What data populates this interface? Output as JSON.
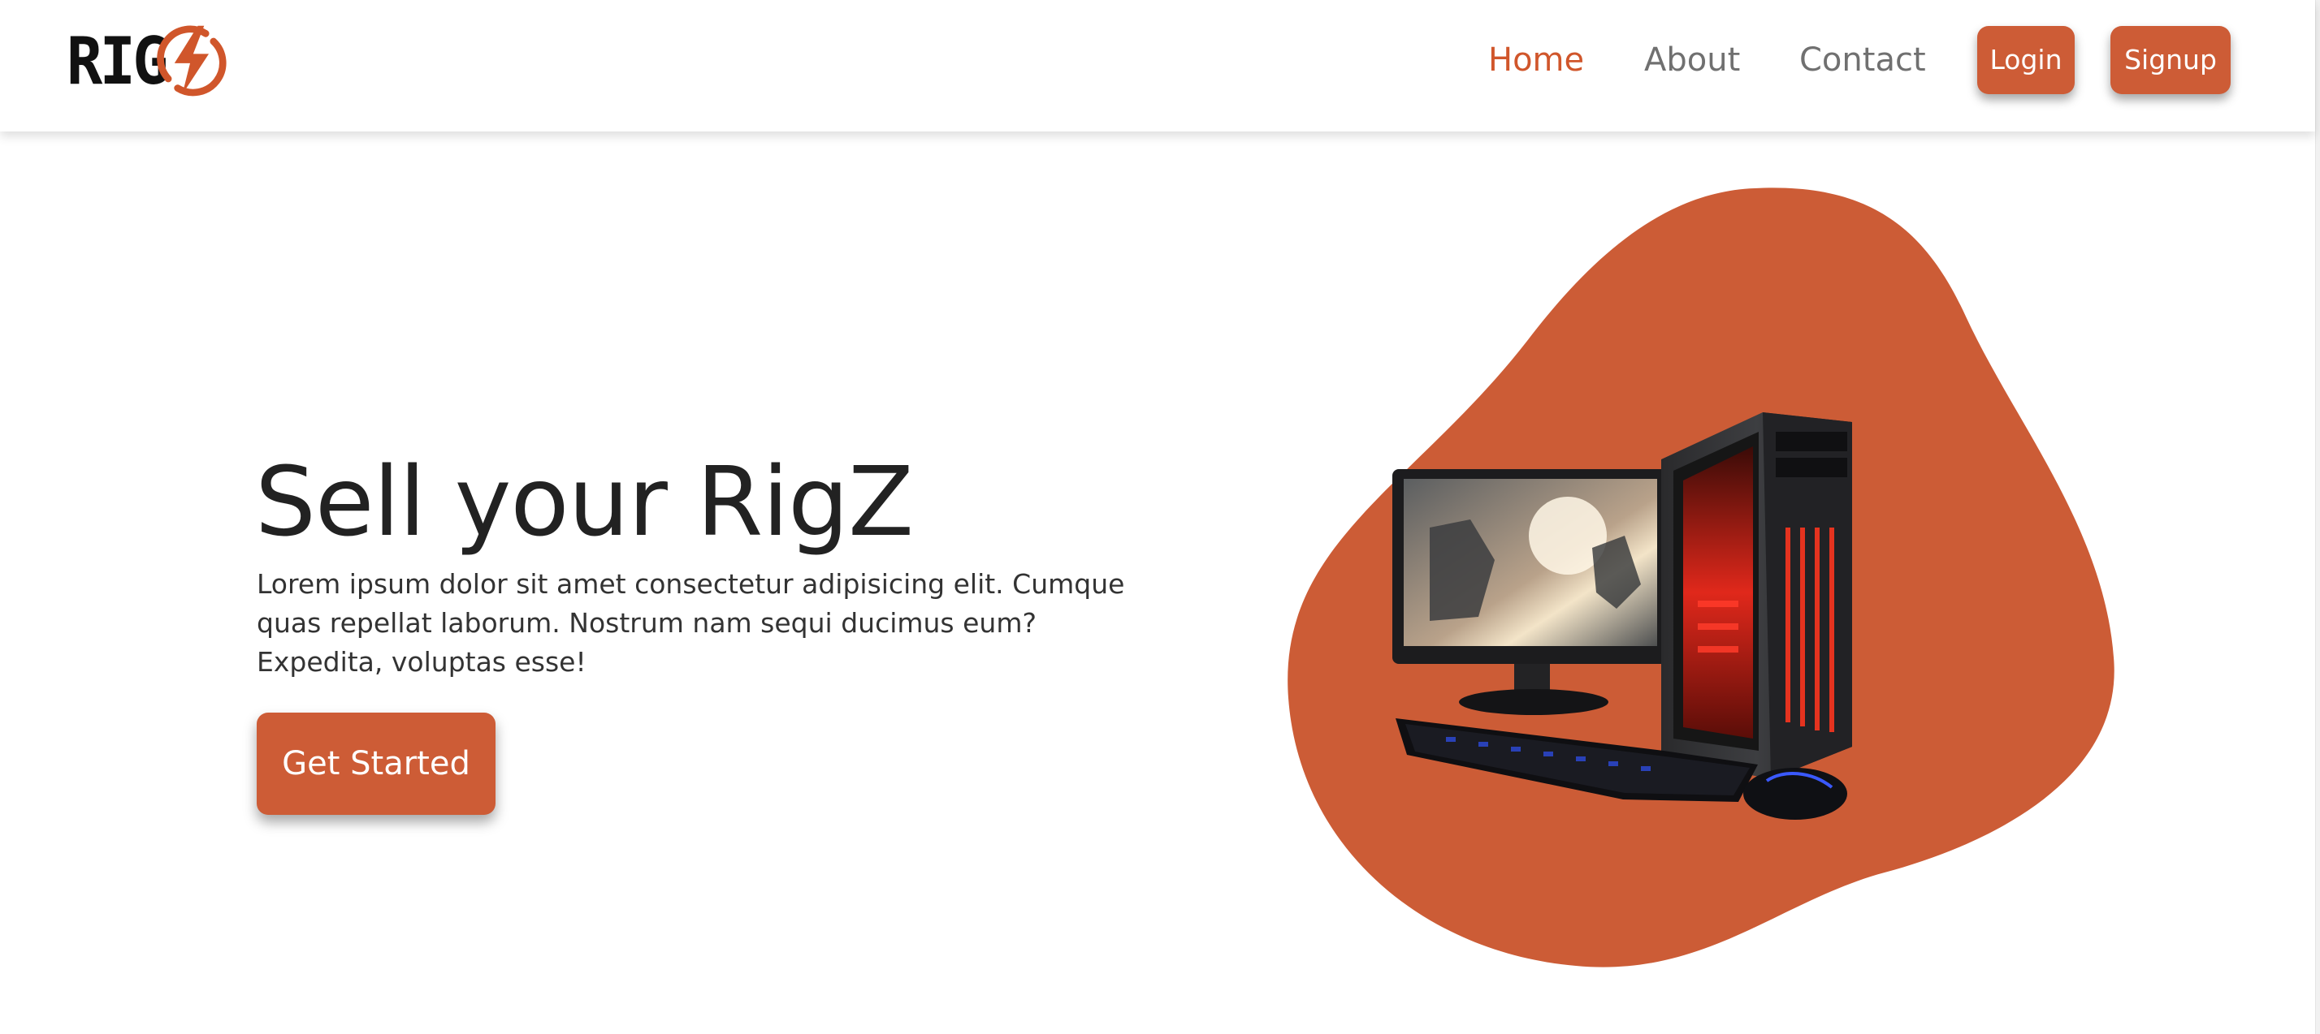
{
  "brand": {
    "logo_text": "RIG",
    "logo_accent_color": "#d0562b"
  },
  "nav": {
    "links": [
      {
        "label": "Home",
        "active": true
      },
      {
        "label": "About",
        "active": false
      },
      {
        "label": "Contact",
        "active": false
      }
    ],
    "login_label": "Login",
    "signup_label": "Signup"
  },
  "hero": {
    "title": "Sell your RigZ",
    "description": "Lorem ipsum dolor sit amet consectetur adipisicing elit. Cumque quas repellat laborum. Nostrum nam sequi ducimus eum? Expedita, voluptas esse!",
    "cta_label": "Get Started",
    "image_subject": "gaming PC setup with monitor, tower, keyboard and mouse",
    "blob_color": "#cc5c36"
  },
  "colors": {
    "accent": "#cd5c36",
    "nav_inactive": "#707070",
    "text_dark": "#222222"
  }
}
